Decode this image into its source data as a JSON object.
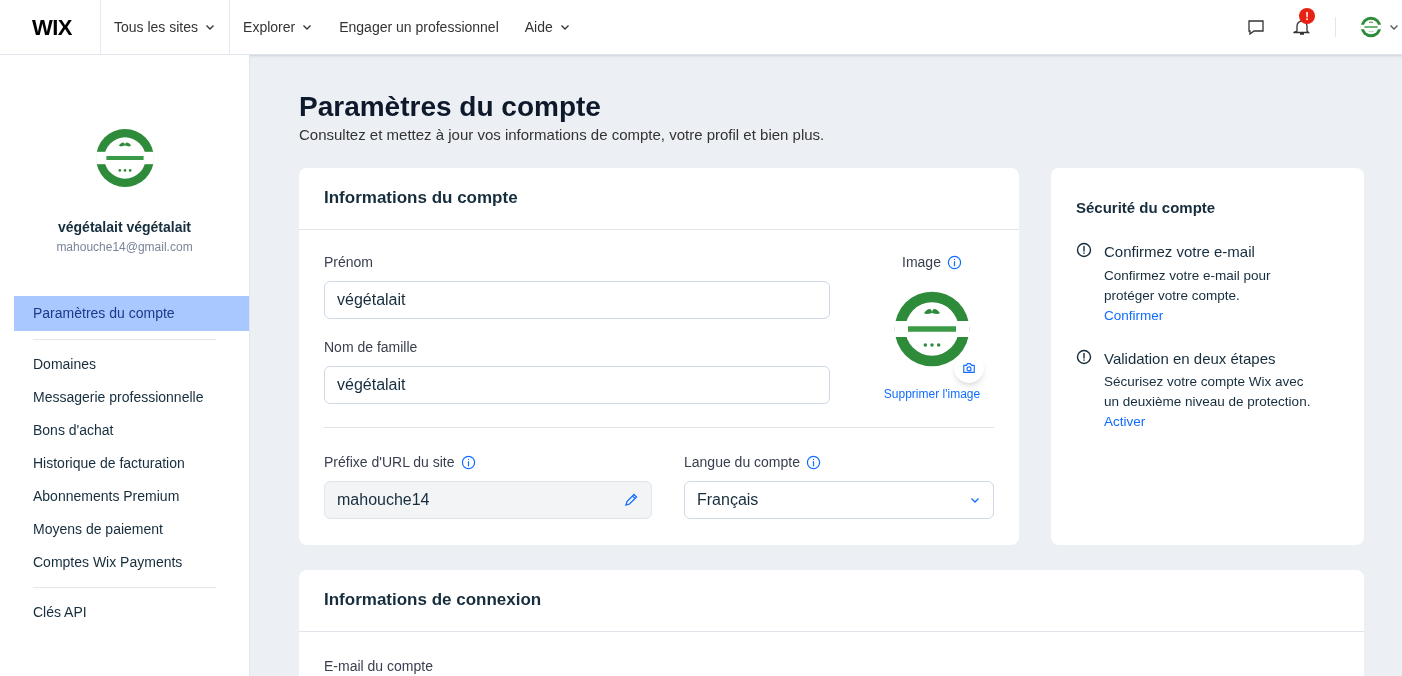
{
  "top_bar": {
    "brand": "WIX",
    "nav": [
      {
        "label": "Tous les sites",
        "dropdown": true,
        "divider_before": true
      },
      {
        "label": "Explorer",
        "dropdown": true,
        "divider_before": true
      },
      {
        "label": "Engager un professionnel",
        "dropdown": false,
        "divider_before": false
      },
      {
        "label": "Aide",
        "dropdown": true,
        "divider_before": false
      }
    ],
    "notification_badge": "!"
  },
  "sidebar": {
    "user_name": "végétalait végétalait",
    "user_email": "mahouche14@gmail.com",
    "groups": [
      [
        {
          "label": "Paramètres du compte",
          "selected": true
        }
      ],
      [
        {
          "label": "Domaines",
          "selected": false
        },
        {
          "label": "Messagerie professionnelle",
          "selected": false
        },
        {
          "label": "Bons d'achat",
          "selected": false
        },
        {
          "label": "Historique de facturation",
          "selected": false
        },
        {
          "label": "Abonnements Premium",
          "selected": false
        },
        {
          "label": "Moyens de paiement",
          "selected": false
        },
        {
          "label": "Comptes Wix Payments",
          "selected": false
        }
      ],
      [
        {
          "label": "Clés API",
          "selected": false
        }
      ]
    ]
  },
  "page": {
    "title": "Paramètres du compte",
    "subtitle": "Consultez et mettez à jour vos informations de compte, votre profil et bien plus."
  },
  "account_card": {
    "title": "Informations du compte",
    "first_name": {
      "label": "Prénom",
      "value": "végétalait"
    },
    "last_name": {
      "label": "Nom de famille",
      "value": "végétalait"
    },
    "image": {
      "label": "Image",
      "remove_link": "Supprimer l'image"
    },
    "url_prefix": {
      "label": "Préfixe d'URL du site",
      "value": "mahouche14"
    },
    "language": {
      "label": "Langue du compte",
      "value": "Français"
    }
  },
  "security_card": {
    "title": "Sécurité du compte",
    "items": [
      {
        "title": "Confirmez votre e-mail",
        "text": "Confirmez votre e-mail pour protéger votre compte.",
        "link": "Confirmer"
      },
      {
        "title": "Validation en deux étapes",
        "text": "Sécurisez votre compte Wix avec un deuxième niveau de protection.",
        "link": "Activer"
      }
    ]
  },
  "login_card": {
    "title": "Informations de connexion",
    "field_label": "E-mail du compte"
  }
}
